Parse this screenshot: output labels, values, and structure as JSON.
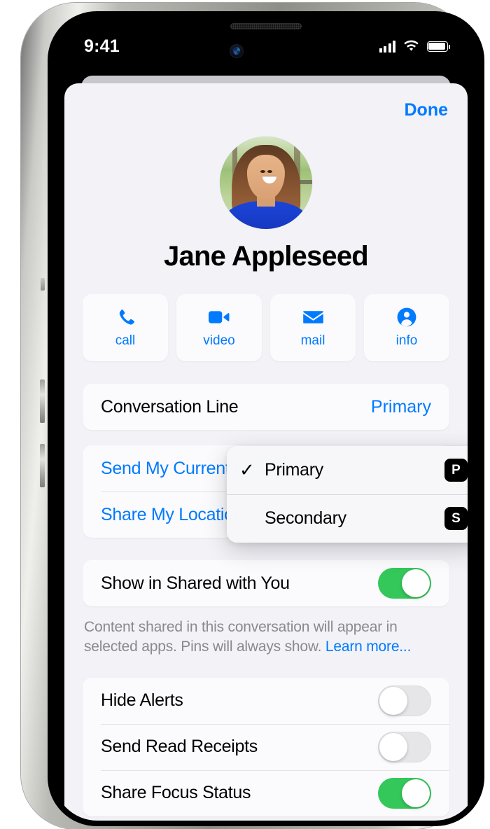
{
  "status_bar": {
    "time": "9:41",
    "cellular_icon": "cellular-bars-icon",
    "wifi_icon": "wifi-icon",
    "battery_icon": "battery-full-icon"
  },
  "sheet": {
    "done_label": "Done",
    "contact": {
      "name": "Jane Appleseed",
      "avatar_alt": "contact-photo"
    },
    "quick_actions": [
      {
        "icon": "phone-icon",
        "label": "call"
      },
      {
        "icon": "video-icon",
        "label": "video"
      },
      {
        "icon": "mail-icon",
        "label": "mail"
      },
      {
        "icon": "person-circle-icon",
        "label": "info"
      }
    ],
    "conversation_line": {
      "label": "Conversation Line",
      "value": "Primary"
    },
    "line_menu": {
      "items": [
        {
          "label": "Primary",
          "checked": "✓",
          "badge": "P"
        },
        {
          "label": "Secondary",
          "checked": "",
          "badge": "S"
        }
      ]
    },
    "location_group": [
      {
        "label": "Send My Current Location"
      },
      {
        "label": "Share My Location"
      }
    ],
    "shared_with_you": {
      "label": "Show in Shared with You",
      "toggle_state": "on",
      "footnote_text": "Content shared in this conversation will appear in selected apps. Pins will always show. ",
      "footnote_link": "Learn more..."
    },
    "alerts_group": [
      {
        "label": "Hide Alerts",
        "toggle_state": "off"
      },
      {
        "label": "Send Read Receipts",
        "toggle_state": "off"
      },
      {
        "label": "Share Focus Status",
        "toggle_state": "on"
      }
    ]
  },
  "colors": {
    "accent_blue": "#007AFF",
    "toggle_green": "#34C759",
    "sheet_background": "#F2F2F7",
    "card_background": "#FBFBFD",
    "footnote_gray": "#8A8A8E"
  }
}
